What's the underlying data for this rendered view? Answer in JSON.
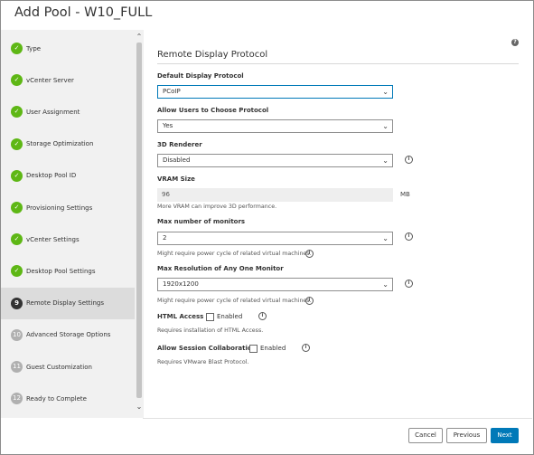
{
  "dialog": {
    "title": "Add Pool - W10_FULL"
  },
  "wizard": {
    "steps": [
      {
        "number": "1",
        "label": "Type",
        "state": "done"
      },
      {
        "number": "2",
        "label": "vCenter Server",
        "state": "done"
      },
      {
        "number": "3",
        "label": "User Assignment",
        "state": "done"
      },
      {
        "number": "4",
        "label": "Storage Optimization",
        "state": "done"
      },
      {
        "number": "5",
        "label": "Desktop Pool ID",
        "state": "done"
      },
      {
        "number": "6",
        "label": "Provisioning Settings",
        "state": "done"
      },
      {
        "number": "7",
        "label": "vCenter Settings",
        "state": "done"
      },
      {
        "number": "8",
        "label": "Desktop Pool Settings",
        "state": "done"
      },
      {
        "number": "9",
        "label": "Remote Display Settings",
        "state": "current"
      },
      {
        "number": "10",
        "label": "Advanced Storage Options",
        "state": "future"
      },
      {
        "number": "11",
        "label": "Guest Customization",
        "state": "future"
      },
      {
        "number": "12",
        "label": "Ready to Complete",
        "state": "future"
      }
    ],
    "check_glyph": "✓",
    "scroll_up_glyph": "⌃",
    "scroll_down_glyph": "⌄"
  },
  "panel": {
    "help_glyph": "?",
    "section_title": "Remote Display Protocol",
    "default_protocol": {
      "label": "Default Display Protocol",
      "value": "PCoIP"
    },
    "allow_choose": {
      "label": "Allow Users to Choose Protocol",
      "value": "Yes"
    },
    "renderer": {
      "label": "3D Renderer",
      "value": "Disabled"
    },
    "vram": {
      "label": "VRAM Size",
      "value": "96",
      "unit": "MB",
      "hint": "More VRAM can improve 3D performance."
    },
    "monitors": {
      "label": "Max number of monitors",
      "value": "2",
      "hint": "Might require power cycle of related virtual machines."
    },
    "resolution": {
      "label": "Max Resolution of Any One Monitor",
      "value": "1920x1200",
      "hint": "Might require power cycle of related virtual machines."
    },
    "html_access": {
      "label": "HTML Access",
      "checkbox_label": "Enabled",
      "checked": false,
      "hint": "Requires installation of HTML Access."
    },
    "collaboration": {
      "label": "Allow Session Collaboration",
      "checkbox_label": "Enabled",
      "checked": false,
      "hint": "Requires VMware Blast Protocol."
    },
    "info_glyph": "i",
    "chevron_glyph": "⌄"
  },
  "footer": {
    "cancel": "Cancel",
    "previous": "Previous",
    "next": "Next"
  },
  "colors": {
    "accent": "#0079b8",
    "done": "#5eb715",
    "current": "#333333",
    "future": "#b0b0b0"
  }
}
